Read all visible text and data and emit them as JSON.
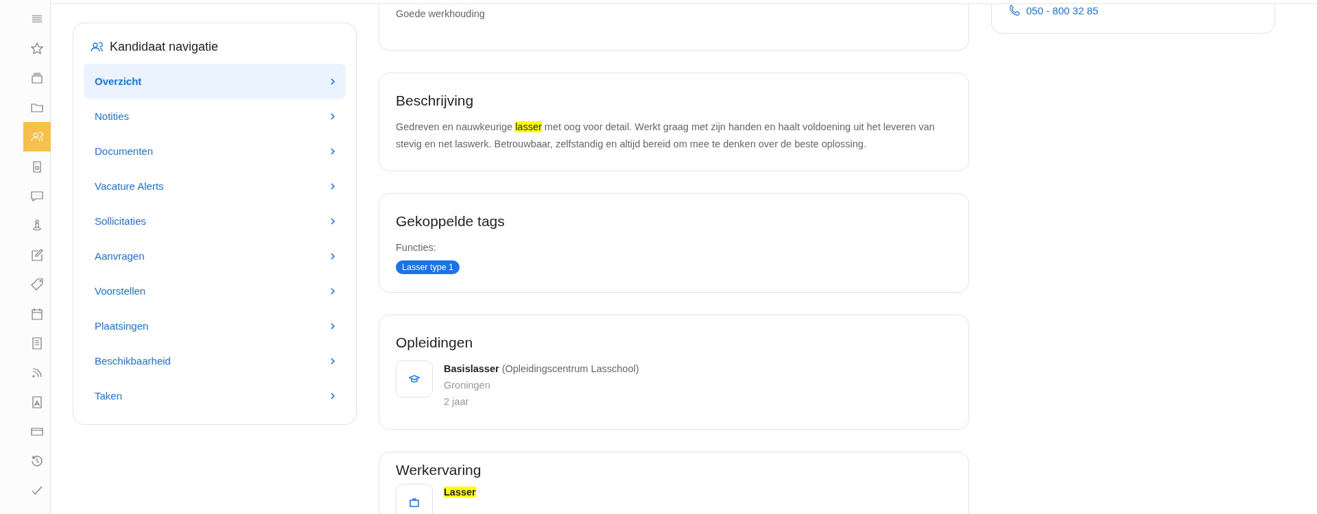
{
  "sidebar": {
    "items": [
      {
        "selected": false
      },
      {
        "selected": false
      },
      {
        "selected": false
      },
      {
        "selected": false
      },
      {
        "selected": true
      },
      {
        "selected": false
      },
      {
        "selected": false
      },
      {
        "selected": false
      },
      {
        "selected": false
      },
      {
        "selected": false
      },
      {
        "selected": false
      },
      {
        "selected": false
      },
      {
        "selected": false
      },
      {
        "selected": false
      },
      {
        "selected": false
      },
      {
        "selected": false
      },
      {
        "selected": false
      }
    ]
  },
  "candidate_nav": {
    "title": "Kandidaat navigatie",
    "items": [
      {
        "label": "Overzicht",
        "selected": true
      },
      {
        "label": "Notities",
        "selected": false
      },
      {
        "label": "Documenten",
        "selected": false
      },
      {
        "label": "Vacature Alerts",
        "selected": false
      },
      {
        "label": "Sollicitaties",
        "selected": false
      },
      {
        "label": "Aanvragen",
        "selected": false
      },
      {
        "label": "Voorstellen",
        "selected": false
      },
      {
        "label": "Plaatsingen",
        "selected": false
      },
      {
        "label": "Beschikbaarheid",
        "selected": false
      },
      {
        "label": "Taken",
        "selected": false
      }
    ]
  },
  "traits_card": {
    "text": "Goede werkhouding"
  },
  "description": {
    "title": "Beschrijving",
    "parts": [
      {
        "text": "Gedreven en nauwkeurige ",
        "highlighted": false
      },
      {
        "text": "lasser",
        "highlighted": true
      },
      {
        "text": " met oog voor detail. Werkt graag met zijn handen en haalt voldoening uit het leveren van stevig en net laswerk. Betrouwbaar, zelfstandig en altijd bereid om mee te denken over de beste oplossing.",
        "highlighted": false
      }
    ]
  },
  "tags": {
    "title": "Gekoppelde tags",
    "label": "Functies:",
    "items": [
      "Lasser type 1"
    ]
  },
  "education": {
    "title": "Opleidingen",
    "items": [
      {
        "heading": "**Basislasser** (Opleidingscentrum Lasschool)",
        "place": "Groningen",
        "duration": "2 jaar"
      }
    ]
  },
  "experience": {
    "title": "Werkervaring",
    "items": [
      {
        "heading": "Lasser",
        "highlighted": true
      }
    ]
  },
  "contact": {
    "phone": "050 - 800 32 85"
  }
}
